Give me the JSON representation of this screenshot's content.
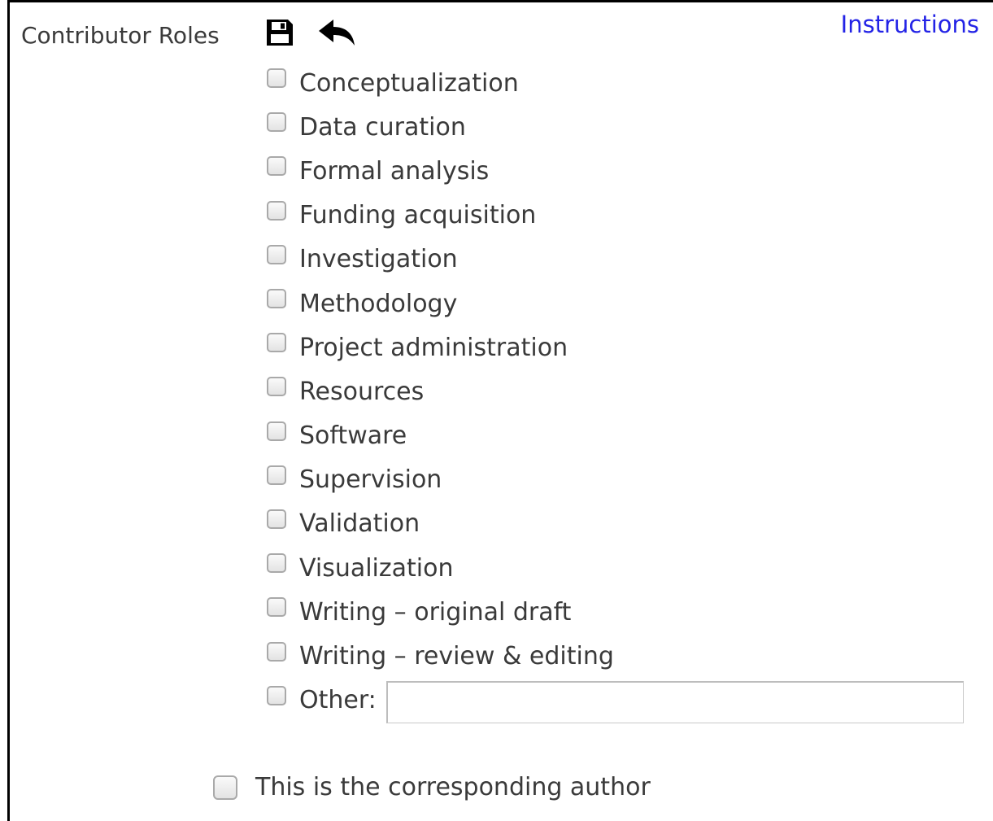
{
  "header": {
    "title": "Contributor Roles",
    "save_icon": "floppy-disk-icon",
    "undo_icon": "reply-arrow-icon",
    "instructions_link": "Instructions"
  },
  "roles": [
    {
      "label": "Conceptualization",
      "checked": false
    },
    {
      "label": "Data curation",
      "checked": false
    },
    {
      "label": "Formal analysis",
      "checked": false
    },
    {
      "label": "Funding acquisition",
      "checked": false
    },
    {
      "label": "Investigation",
      "checked": false
    },
    {
      "label": "Methodology",
      "checked": false
    },
    {
      "label": "Project administration",
      "checked": false
    },
    {
      "label": "Resources",
      "checked": false
    },
    {
      "label": "Software",
      "checked": false
    },
    {
      "label": "Supervision",
      "checked": false
    },
    {
      "label": "Validation",
      "checked": false
    },
    {
      "label": "Visualization",
      "checked": false
    },
    {
      "label": "Writing – original draft",
      "checked": false
    },
    {
      "label": "Writing – review & editing",
      "checked": false
    }
  ],
  "other": {
    "label": "Other:",
    "checked": false,
    "value": ""
  },
  "corresponding_author": {
    "label": "This is the corresponding author",
    "checked": false
  },
  "colors": {
    "link": "#2323e6",
    "text": "#3a3a3a",
    "border": "#000000"
  }
}
